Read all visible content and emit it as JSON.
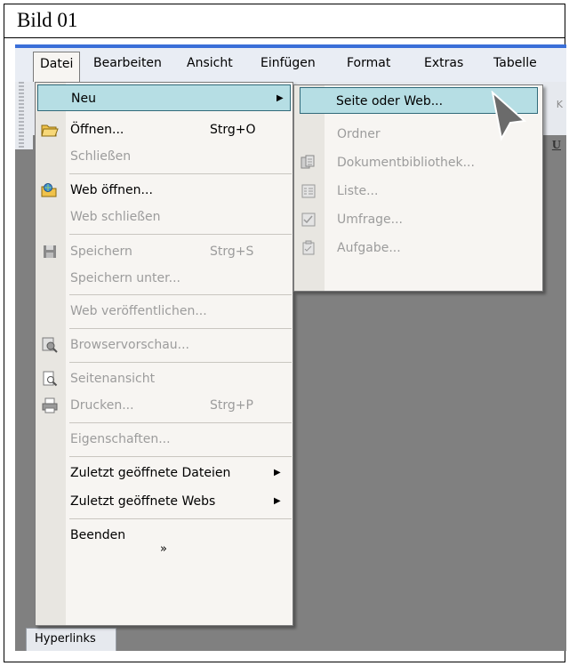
{
  "caption": "Bild 01",
  "menubar": {
    "items": [
      "Datei",
      "Bearbeiten",
      "Ansicht",
      "Einfügen",
      "Format",
      "Extras",
      "Tabelle"
    ]
  },
  "datei_menu": {
    "items": [
      {
        "label": "Neu",
        "shortcut": "",
        "submenu": true,
        "icon": "",
        "state": "highlighted"
      },
      {
        "label": "Öffnen...",
        "shortcut": "Strg+O",
        "submenu": false,
        "icon": "open-folder-icon",
        "state": "enabled"
      },
      {
        "label": "Schließen",
        "shortcut": "",
        "submenu": false,
        "icon": "",
        "state": "disabled"
      },
      {
        "label": "Web öffnen...",
        "shortcut": "",
        "submenu": false,
        "icon": "open-web-icon",
        "state": "enabled"
      },
      {
        "label": "Web schließen",
        "shortcut": "",
        "submenu": false,
        "icon": "",
        "state": "disabled"
      },
      {
        "label": "Speichern",
        "shortcut": "Strg+S",
        "submenu": false,
        "icon": "save-icon",
        "state": "disabled"
      },
      {
        "label": "Speichern unter...",
        "shortcut": "",
        "submenu": false,
        "icon": "",
        "state": "disabled"
      },
      {
        "label": "Web veröffentlichen...",
        "shortcut": "",
        "submenu": false,
        "icon": "",
        "state": "disabled"
      },
      {
        "label": "Browservorschau...",
        "shortcut": "",
        "submenu": false,
        "icon": "browser-preview-icon",
        "state": "disabled"
      },
      {
        "label": "Seitenansicht",
        "shortcut": "",
        "submenu": false,
        "icon": "print-preview-icon",
        "state": "disabled"
      },
      {
        "label": "Drucken...",
        "shortcut": "Strg+P",
        "submenu": false,
        "icon": "print-icon",
        "state": "disabled"
      },
      {
        "label": "Eigenschaften...",
        "shortcut": "",
        "submenu": false,
        "icon": "",
        "state": "disabled"
      },
      {
        "label": "Zuletzt geöffnete Dateien",
        "shortcut": "",
        "submenu": true,
        "icon": "",
        "state": "enabled"
      },
      {
        "label": "Zuletzt geöffnete Webs",
        "shortcut": "",
        "submenu": true,
        "icon": "",
        "state": "enabled"
      },
      {
        "label": "Beenden",
        "shortcut": "",
        "submenu": false,
        "icon": "",
        "state": "enabled"
      }
    ],
    "expand_glyph": "»"
  },
  "neu_submenu": {
    "items": [
      {
        "label": "Seite oder Web...",
        "icon": "",
        "state": "highlighted"
      },
      {
        "label": "Ordner",
        "icon": "",
        "state": "disabled"
      },
      {
        "label": "Dokumentbibliothek...",
        "icon": "document-library-icon",
        "state": "disabled"
      },
      {
        "label": "Liste...",
        "icon": "list-icon",
        "state": "disabled"
      },
      {
        "label": "Umfrage...",
        "icon": "survey-icon",
        "state": "disabled"
      },
      {
        "label": "Aufgabe...",
        "icon": "task-icon",
        "state": "disabled"
      }
    ]
  },
  "toolbar": {
    "underline_label": "U",
    "k_label": "K"
  },
  "status_tab": "Hyperlinks",
  "colors": {
    "highlight": "#b6dee4",
    "highlight_border": "#316a7a",
    "workspace": "#808080",
    "accent": "#3a6fd8"
  }
}
